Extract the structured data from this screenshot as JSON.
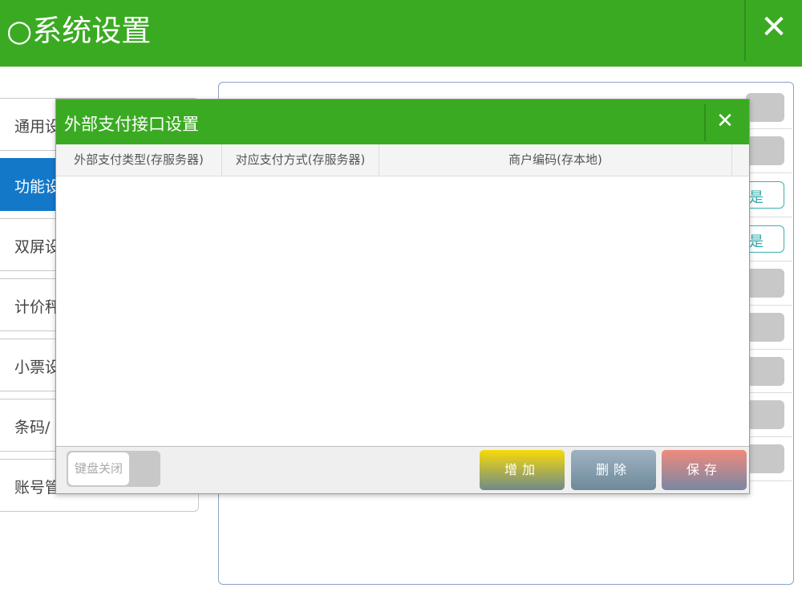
{
  "window": {
    "title": "○系统设置",
    "close_glyph": "✕"
  },
  "nav": {
    "items": [
      {
        "label": "通用设"
      },
      {
        "label": "功能设"
      },
      {
        "label": "双屏设"
      },
      {
        "label": "计价秤"
      },
      {
        "label": "小票设"
      },
      {
        "label": "条码/"
      },
      {
        "label": "账号管"
      }
    ],
    "active_index": 1
  },
  "settings_panel": {
    "yes_label": "是"
  },
  "dialog": {
    "title": "外部支付接口设置",
    "close_glyph": "✕",
    "columns": [
      "外部支付类型(存服务器)",
      "对应支付方式(存服务器)",
      "商户编码(存本地)"
    ],
    "rows": [],
    "keyboard_toggle_label": "键盘关闭",
    "buttons": {
      "add": "增加",
      "delete": "删除",
      "save": "保存"
    }
  },
  "colors": {
    "brand_green": "#3aaa22",
    "active_blue": "#1478c8"
  }
}
